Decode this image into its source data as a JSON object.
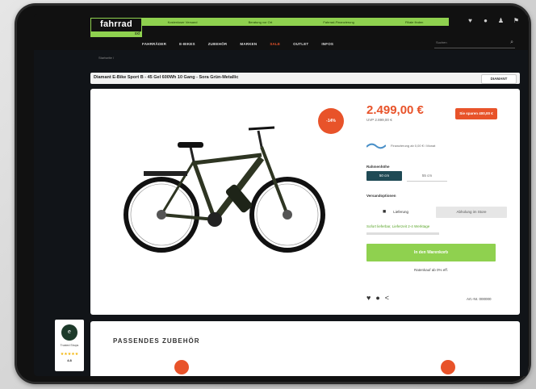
{
  "header": {
    "logo_text": "fahrrad",
    "logo_sub": "xxl",
    "top_links": [
      "Kostenloser Versand",
      "Beratung vor Ort",
      "Fahrrad-Finanzierung",
      "Filiale finden"
    ],
    "icons": [
      "heart-icon",
      "location-icon",
      "user-icon",
      "cart-icon"
    ]
  },
  "nav": {
    "items": [
      "FAHRRÄDER",
      "E-BIKES",
      "ZUBEHÖR",
      "MARKEN",
      "SALE",
      "OUTLET",
      "INFOS"
    ],
    "search_placeholder": "Suchen"
  },
  "breadcrumb": "Startseite /",
  "product": {
    "title": "Diamant E-Bike Sport B - 45 Gel 600Wh 10 Gang - Sora Grün-Metallic",
    "brand": "DIAMANT",
    "discount_badge": "-14%",
    "price": "2.499,00 €",
    "uvp": "UVP 2.899,00 €",
    "save_label": "Sie sparen 400,00 €",
    "finance_text": "Finanzierung ab 0,00 € / Monat",
    "size_label": "Rahmenhöhe",
    "size_selected": "50 cm",
    "size_other": "55 cm",
    "versand_label": "Versandoptionen",
    "ship_option_1": "Lieferung",
    "ship_option_2": "Abholung im Store",
    "availability": "Sofort lieferbar, Lieferzeit 2-4 Werktage",
    "cart_button": "In den Warenkorb",
    "under_button": "Ratenkauf ab 0% eff.",
    "artnr": "Art.-Nr. 000000",
    "share_icons": [
      "heart-icon",
      "info-icon",
      "share-icon"
    ]
  },
  "trust": {
    "label": "Trusted Shops",
    "stars": "★★★★★",
    "score": "4.8"
  },
  "accessories": {
    "heading": "PASSENDES ZUBEHÖR"
  },
  "colors": {
    "accent_green": "#8fd14f",
    "accent_orange": "#e8532a",
    "dark": "#111418"
  }
}
